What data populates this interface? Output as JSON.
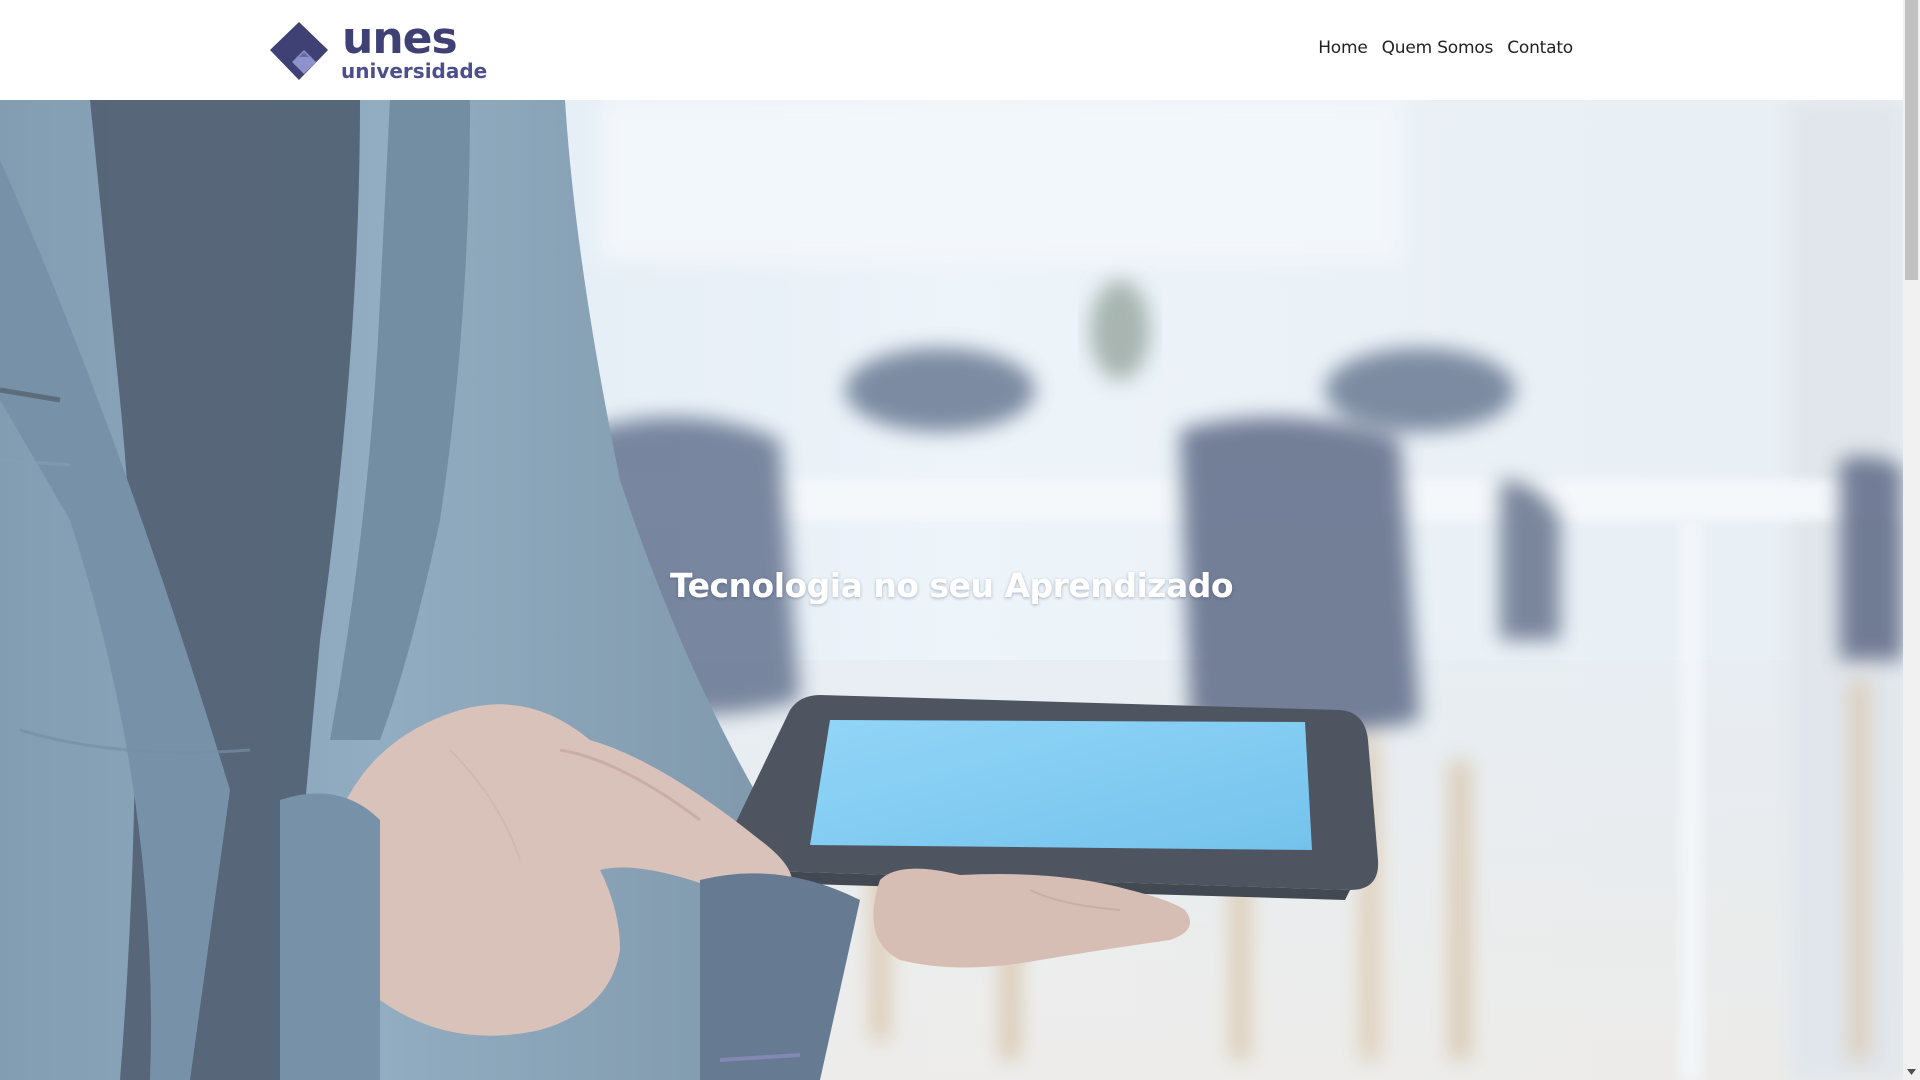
{
  "header": {
    "logo": {
      "wordmark": "unes",
      "subtitle": "universidade",
      "color": "#3f4175"
    },
    "nav": [
      {
        "label": "Home"
      },
      {
        "label": "Quem Somos"
      },
      {
        "label": "Contato"
      }
    ]
  },
  "hero": {
    "title": "Tecnologia no seu Aprendizado",
    "background": "photo-businessman-holding-tablet"
  },
  "colors": {
    "brand": "#3f4175",
    "brand_light": "#6b6fb0",
    "tablet_screen": "#6ec6f3"
  },
  "icons": {
    "logo_mark": "diamond-logo-icon",
    "scroll_down": "scroll-down-arrow-icon"
  }
}
